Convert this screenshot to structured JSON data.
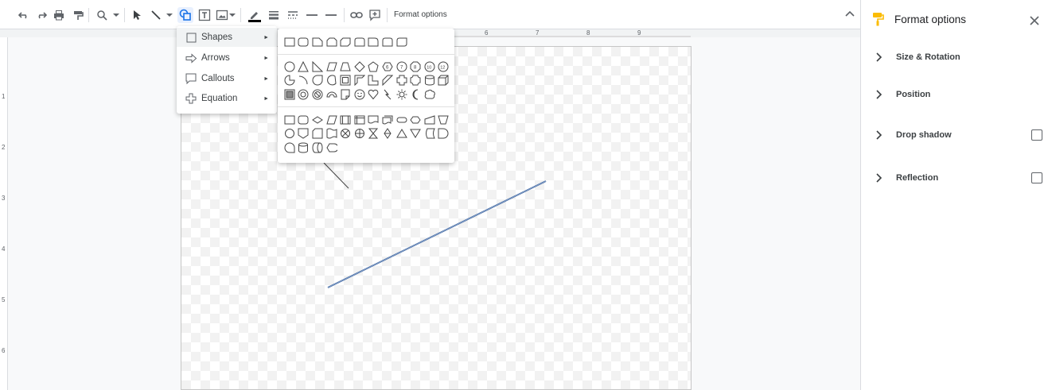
{
  "toolbar": {
    "buttons": [
      {
        "name": "undo-icon"
      },
      {
        "name": "redo-icon"
      },
      {
        "name": "print-icon"
      },
      {
        "name": "paint-format-icon"
      },
      {
        "name": "zoom-icon"
      },
      {
        "name": "select-icon"
      },
      {
        "name": "line-icon"
      },
      {
        "name": "shape-icon"
      },
      {
        "name": "text-box-icon"
      },
      {
        "name": "image-icon"
      },
      {
        "name": "line-color-icon"
      },
      {
        "name": "line-weight-icon"
      },
      {
        "name": "line-dash-icon"
      },
      {
        "name": "line-start-icon"
      },
      {
        "name": "line-end-icon"
      },
      {
        "name": "link-icon"
      },
      {
        "name": "comment-icon"
      }
    ],
    "format_options_label": "Format options",
    "line_color": "#000000"
  },
  "ruler": {
    "top_labels": [
      "6",
      "7",
      "8",
      "9"
    ],
    "left_labels": [
      "1",
      "2",
      "3",
      "4",
      "5",
      "6"
    ]
  },
  "shape_menu": {
    "items": [
      {
        "label": "Shapes",
        "icon": "square-icon"
      },
      {
        "label": "Arrows",
        "icon": "arrow-icon"
      },
      {
        "label": "Callouts",
        "icon": "callout-icon"
      },
      {
        "label": "Equation",
        "icon": "plus-icon"
      }
    ],
    "submenu_arrow": "►"
  },
  "panel": {
    "title": "Format options",
    "accent_color": "#fbbc04",
    "sections": [
      {
        "label": "Size & Rotation",
        "has_checkbox": false
      },
      {
        "label": "Position",
        "has_checkbox": false
      },
      {
        "label": "Drop shadow",
        "has_checkbox": true,
        "checked": false
      },
      {
        "label": "Reflection",
        "has_checkbox": true,
        "checked": false
      }
    ]
  },
  "canvas": {
    "selected_line_color": "#4a6fa5",
    "other_line_color": "#444444"
  }
}
